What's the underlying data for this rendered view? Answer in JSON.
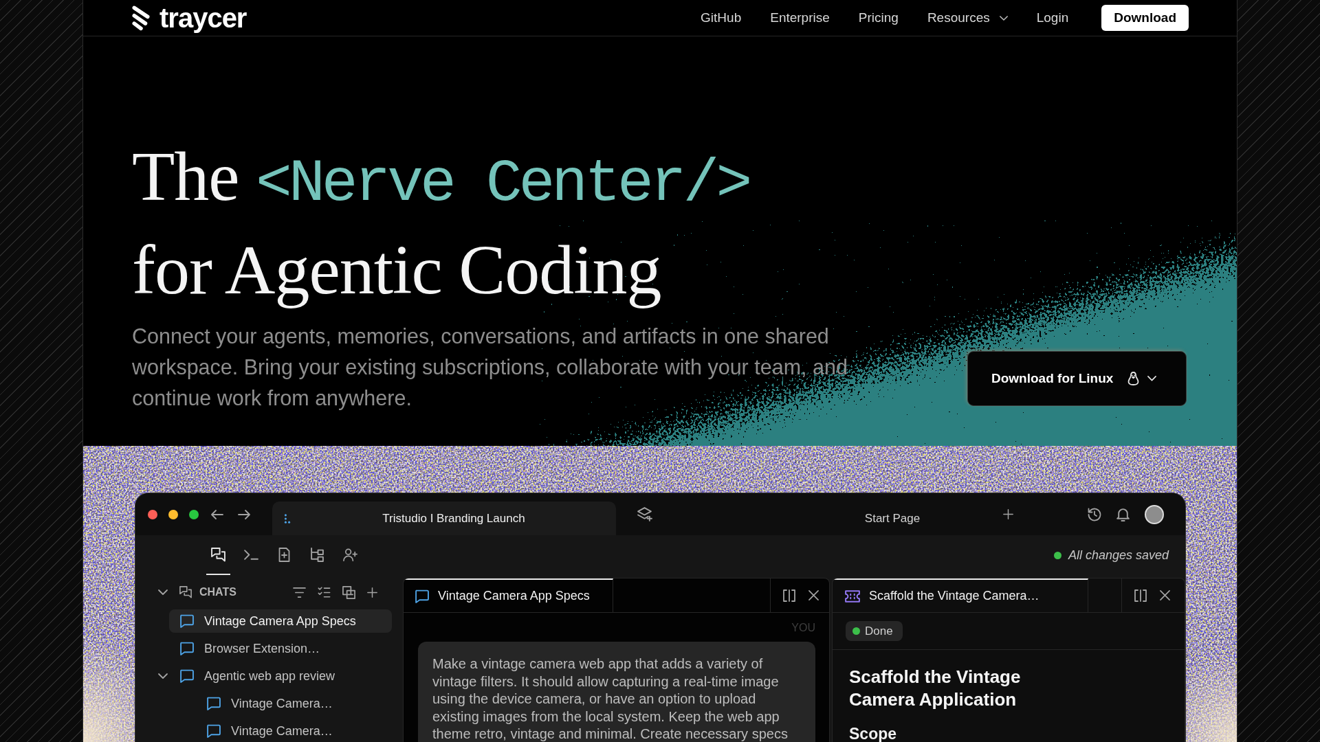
{
  "nav": {
    "logo": "traycer",
    "links": [
      {
        "kind": "link",
        "label": "GitHub"
      },
      {
        "kind": "link",
        "label": "Enterprise"
      },
      {
        "kind": "link",
        "label": "Pricing"
      },
      {
        "kind": "menu",
        "label": "Resources"
      },
      {
        "kind": "link",
        "label": "Login"
      }
    ],
    "button": "Download"
  },
  "hero": {
    "headline": {
      "lead": "The",
      "code": "<Nerve Center/>",
      "rest": "for Agentic Coding"
    },
    "description": "Connect your agents, memories, conversations, and artifacts in one shared workspace. Bring your existing subscriptions, collaborate with your team, and continue work from anywhere.",
    "download_button": "Download for Linux"
  },
  "app": {
    "tabs": [
      {
        "kind": "project",
        "label": "Tristudio I Branding Launch",
        "selected": true
      },
      {
        "kind": "page",
        "label": "Start Page",
        "selected": false
      }
    ],
    "toolbar": [
      {
        "selected": true
      },
      {
        "selected": false
      },
      {
        "selected": false
      },
      {
        "selected": false
      },
      {
        "selected": false
      }
    ],
    "save_status": "All changes saved",
    "sidebar": {
      "section": "CHATS",
      "expanded": true,
      "items": [
        {
          "label": "Vintage Camera App Specs",
          "selected": true
        },
        {
          "label": "Browser Extension…",
          "selected": false
        },
        {
          "label": "Agentic web app review",
          "selected": false,
          "expanded": true,
          "children": [
            {
              "label": "Vintage Camera…",
              "selected": false
            },
            {
              "label": "Vintage Camera…",
              "selected": false
            }
          ]
        }
      ]
    },
    "panes": [
      {
        "kind": "chat",
        "tab": "Vintage Camera App Specs",
        "selected": true,
        "sender": "YOU",
        "message": "Make a vintage camera web app that adds a variety of vintage filters. It should allow capturing a real-time image using the device camera, or have an option to upload existing images from the local system. Keep the web app theme retro, vintage and minimal. Create necessary specs"
      },
      {
        "kind": "task",
        "tab": "Scaffold the Vintage Camera…",
        "selected": true,
        "status": "Done",
        "heading": "Scaffold the Vintage Camera Application",
        "section": "Scope"
      }
    ]
  }
}
